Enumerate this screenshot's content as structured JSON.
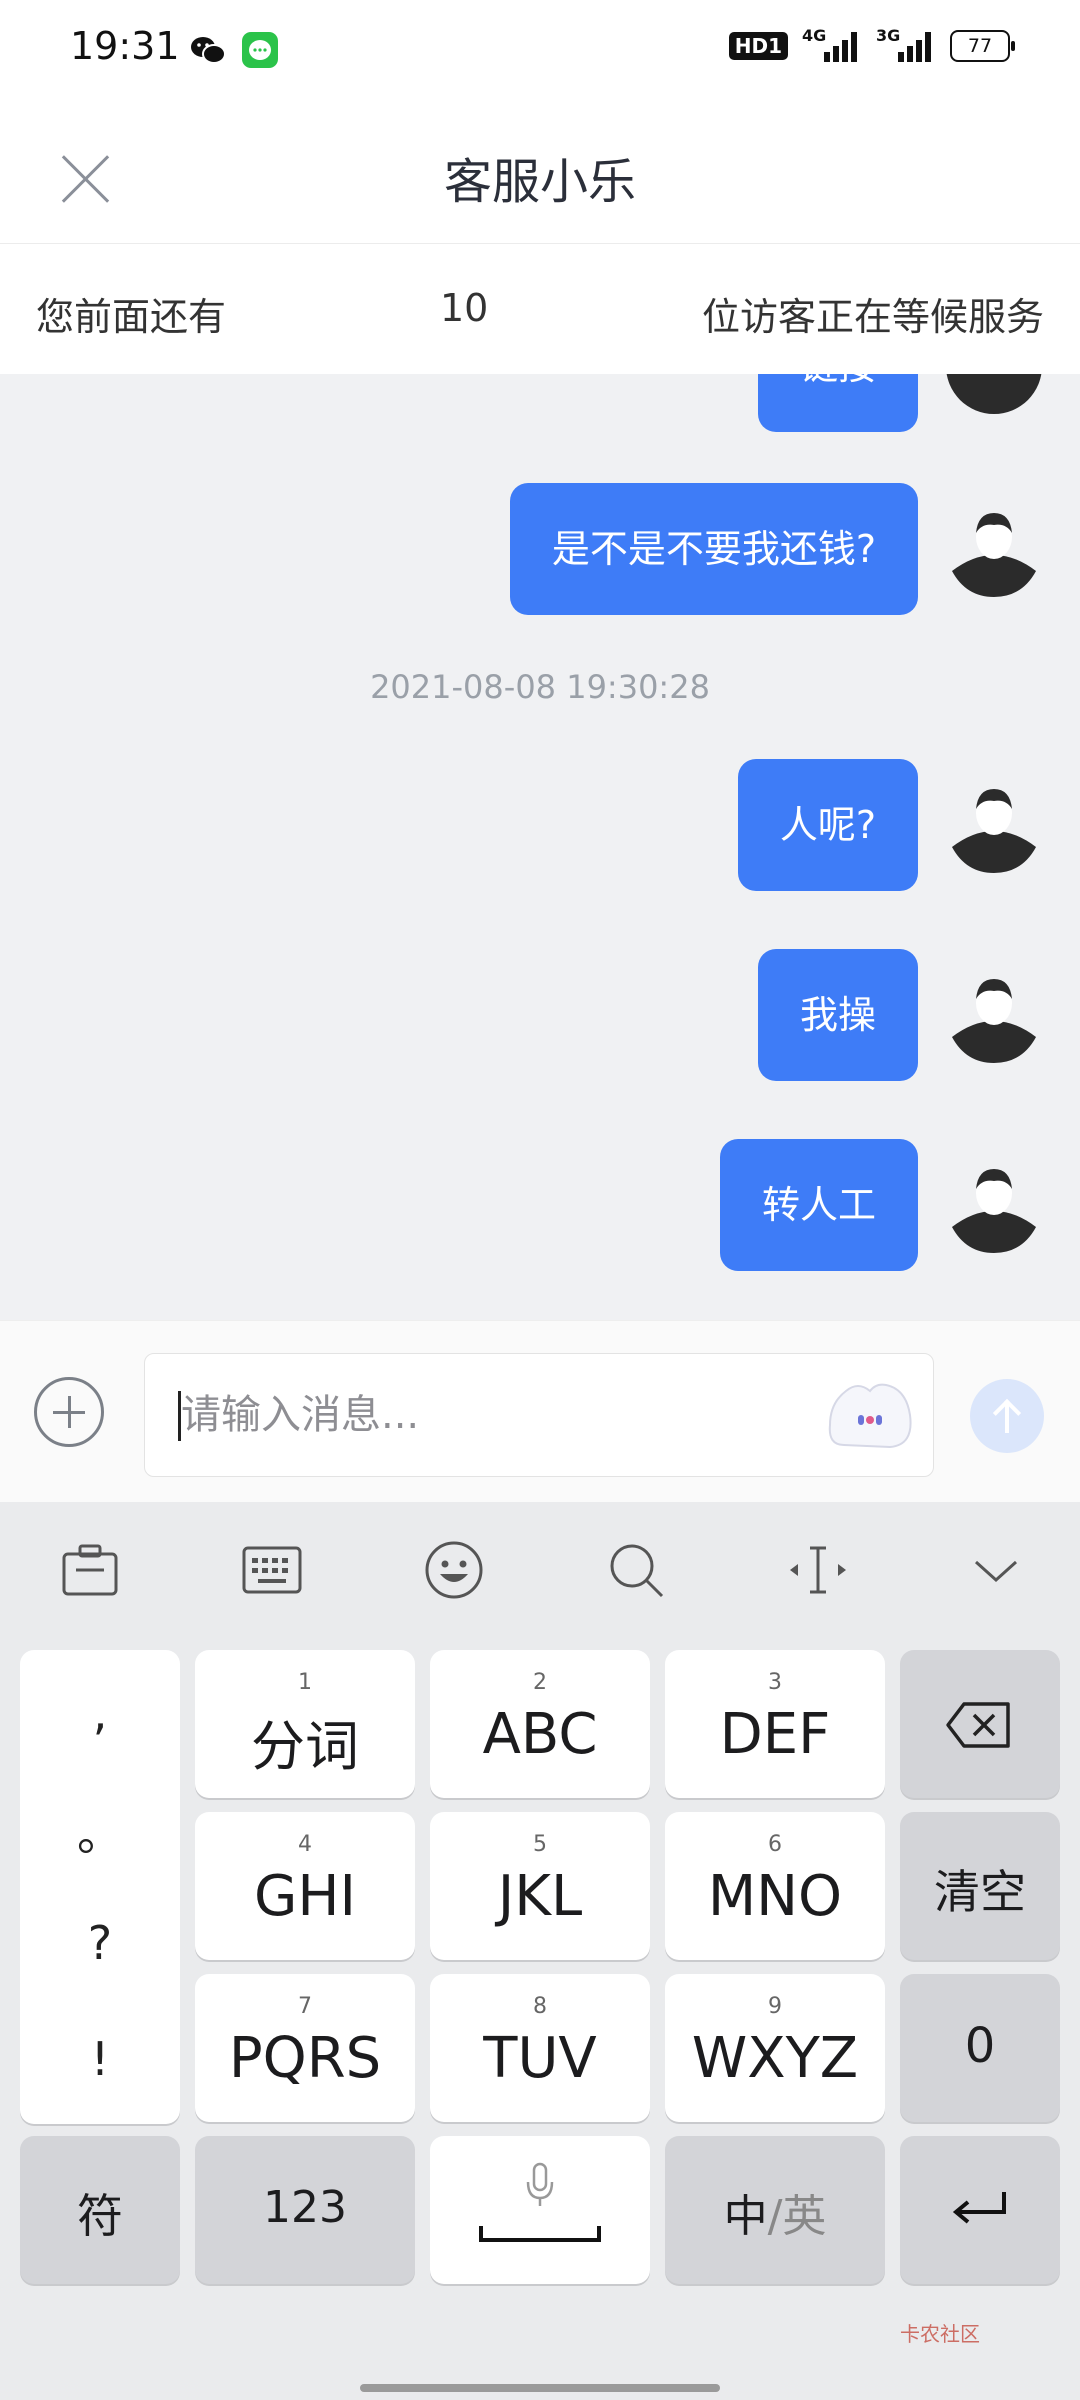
{
  "status_bar": {
    "time": "19:31",
    "network_badge": "HD1",
    "signal1": "4G",
    "signal2": "3G",
    "battery": "77",
    "icons": [
      "wechat-icon",
      "message-app-icon",
      "signal-icon",
      "battery-icon"
    ]
  },
  "header": {
    "title": "客服小乐",
    "close_icon": "close-icon"
  },
  "queue": {
    "prefix": "您前面还有",
    "count": "10",
    "suffix": "位访客正在等候服务"
  },
  "chat": {
    "messages": [
      {
        "text": "链接",
        "partial": true
      },
      {
        "text": "是不是不要我还钱?"
      },
      {
        "text": "人呢?"
      },
      {
        "text": "我操"
      },
      {
        "text": "转人工"
      }
    ],
    "timestamp": "2021-08-08 19:30:28"
  },
  "input": {
    "placeholder": "请输入消息...",
    "value": ""
  },
  "keyboard": {
    "toolbar": [
      "clipboard-icon",
      "keyboard-icon",
      "emoji-icon",
      "search-icon",
      "cursor-icon",
      "collapse-icon"
    ],
    "punct": [
      ",",
      "。",
      "?",
      "!"
    ],
    "keys": [
      {
        "num": "1",
        "label": "分词"
      },
      {
        "num": "2",
        "label": "ABC"
      },
      {
        "num": "3",
        "label": "DEF"
      },
      {
        "num": "4",
        "label": "GHI"
      },
      {
        "num": "5",
        "label": "JKL"
      },
      {
        "num": "6",
        "label": "MNO"
      },
      {
        "num": "7",
        "label": "PQRS"
      },
      {
        "num": "8",
        "label": "TUV"
      },
      {
        "num": "9",
        "label": "WXYZ"
      }
    ],
    "clear": "清空",
    "zero": "0",
    "symbol": "符",
    "numbers": "123",
    "lang_cn": "中",
    "lang_sep": "/",
    "lang_en": "英"
  },
  "watermark": "卡农社区",
  "colors": {
    "bubble": "#3e7cf7",
    "chat_bg": "#f0f1f3",
    "keyboard_bg": "#eaebed"
  }
}
